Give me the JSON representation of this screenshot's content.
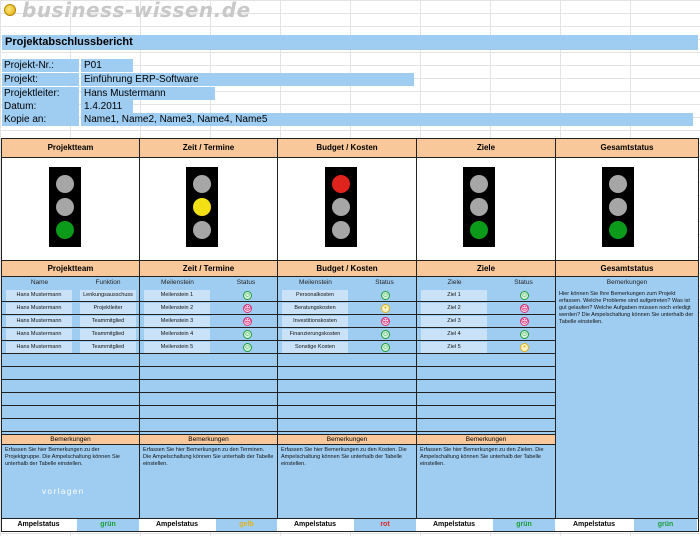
{
  "watermark": "business-wissen.de",
  "watermark2": "vorlagen",
  "title": "Projektabschlussbericht",
  "meta": [
    {
      "label": "Projekt-Nr.:",
      "value": "P01"
    },
    {
      "label": "Projekt:",
      "value": "Einführung ERP-Software"
    },
    {
      "label": "Projektleiter:",
      "value": "Hans Mustermann"
    },
    {
      "label": "Datum:",
      "value": "1.4.2011"
    },
    {
      "label": "Kopie an:",
      "value": "Name1, Name2, Name3, Name4, Name5"
    }
  ],
  "columns": [
    {
      "title": "Projektteam"
    },
    {
      "title": "Zeit / Termine"
    },
    {
      "title": "Budget / Kosten"
    },
    {
      "title": "Ziele"
    },
    {
      "title": "Gesamtstatus"
    }
  ],
  "team": {
    "col1": "Name",
    "col2": "Funktion",
    "rows": [
      [
        "Hans Mustermann",
        "Lenkungsausschuss"
      ],
      [
        "Hans Mustermann",
        "Projektleiter"
      ],
      [
        "Hans Mustermann",
        "Teammitglied"
      ],
      [
        "Hans Mustermann",
        "Teammitglied"
      ],
      [
        "Hans Mustermann",
        "Teammitglied"
      ]
    ],
    "remarks": "Erfassen Sie hier Bemerkungen zu der Projektgruppe. Die Ampelschaltung können Sie unterhalb der Tabelle einstellen."
  },
  "time": {
    "col1": "Meilenstein",
    "col2": "Status",
    "rows": [
      [
        "Meilenstein 1",
        "g"
      ],
      [
        "Meilenstein 2",
        "r"
      ],
      [
        "Meilenstein 3",
        "r"
      ],
      [
        "Meilenstein 4",
        "g"
      ],
      [
        "Meilenstein 5",
        "g"
      ]
    ],
    "remarks": "Erfassen Sie hier Bemerkungen zu den Terminen. Die Ampelschaltung können Sie unterhalb der Tabelle einstellen."
  },
  "budget": {
    "col1": "Meilenstein",
    "col2": "Status",
    "rows": [
      [
        "Personalkosten",
        "g"
      ],
      [
        "Beratungskosten",
        "y"
      ],
      [
        "Investitionskosten",
        "r"
      ],
      [
        "Finanzierungskosten",
        "g"
      ],
      [
        "Sonstige Kosten",
        "g"
      ]
    ],
    "remarks": "Erfassen Sie hier Bemerkungen zu den Kosten. Die Ampelschaltung können Sie unterhalb der Tabelle einstellen."
  },
  "goals": {
    "col1": "Ziele",
    "col2": "Status",
    "rows": [
      [
        "Ziel 1",
        "g"
      ],
      [
        "Ziel 2",
        "r"
      ],
      [
        "Ziel 3",
        "r"
      ],
      [
        "Ziel 4",
        "g"
      ],
      [
        "Ziel 5",
        "y"
      ]
    ],
    "remarks": "Erfassen Sie hier Bemerkungen zu den Zielen. Die Ampelschaltung können Sie unterhalb der Tabelle einstellen."
  },
  "overall": {
    "col1": "Bemerkungen",
    "remarks": "Hier können Sie Ihre Bemerkungen zum Projekt erfassen. Welche Probleme sind aufgetreten? Was ist gut gelaufen? Welche Aufgaben müssen noch erledigt werden? Die Ampelschaltung können Sie unterhalb der Tabelle einstellen."
  },
  "remarks_label": "Bemerkungen",
  "status_label": "Ampelstatus",
  "statuses": [
    "grün",
    "gelb",
    "rot",
    "grün",
    "grün"
  ]
}
